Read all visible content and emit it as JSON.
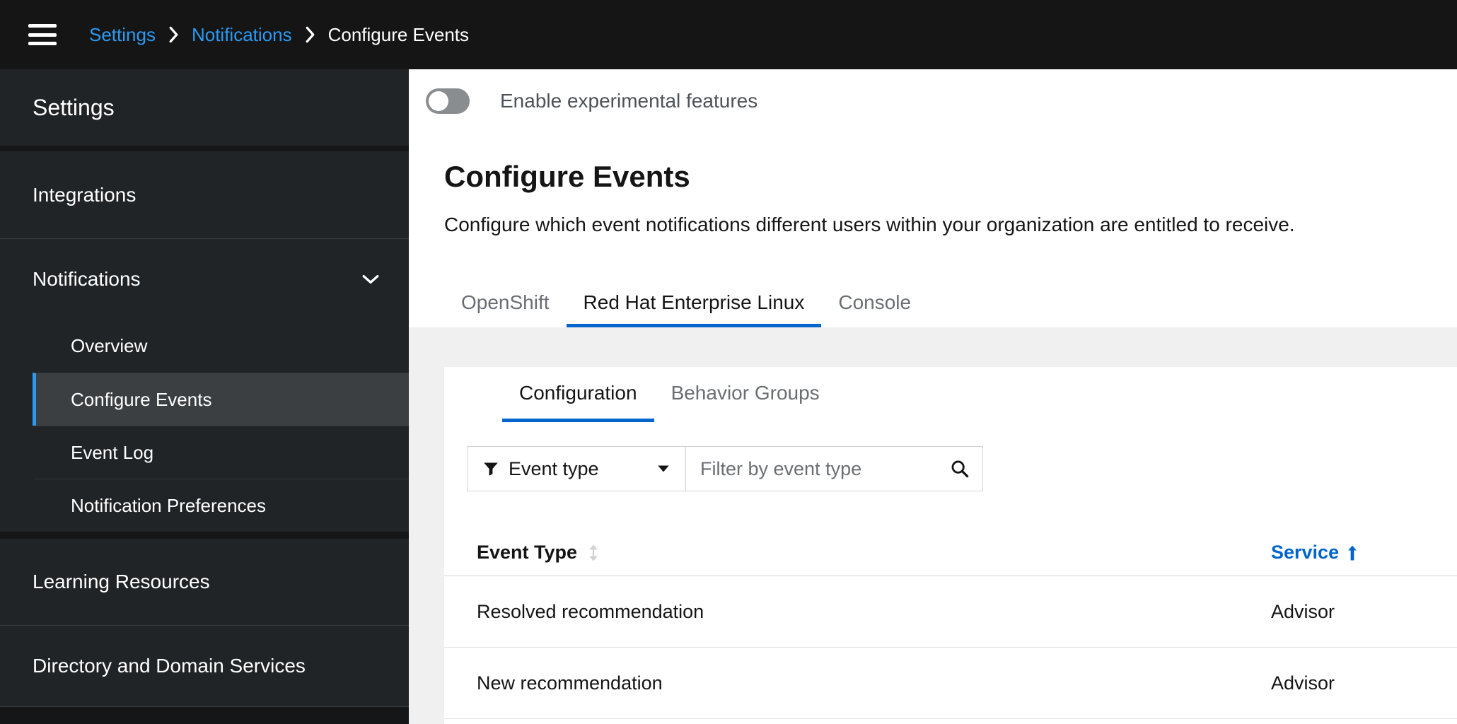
{
  "breadcrumb": {
    "items": [
      {
        "label": "Settings"
      },
      {
        "label": "Notifications"
      },
      {
        "label": "Configure Events"
      }
    ]
  },
  "sidebar": {
    "title": "Settings",
    "integrations": "Integrations",
    "notifications": "Notifications",
    "subitems": [
      {
        "label": "Overview"
      },
      {
        "label": "Configure Events"
      },
      {
        "label": "Event Log"
      },
      {
        "label": "Notification Preferences"
      }
    ],
    "learning": "Learning Resources",
    "directory": "Directory and Domain Services"
  },
  "main": {
    "toggle_label": "Enable experimental features",
    "toggle_state": "off",
    "title": "Configure Events",
    "description": "Configure which event notifications different users within your organization are entitled to receive.",
    "tabs": [
      {
        "label": "OpenShift"
      },
      {
        "label": "Red Hat Enterprise Linux"
      },
      {
        "label": "Console"
      }
    ],
    "subtabs": [
      {
        "label": "Configuration"
      },
      {
        "label": "Behavior Groups"
      }
    ],
    "filter": {
      "dropdown_label": "Event type",
      "placeholder": "Filter by event type"
    },
    "table": {
      "col_event": "Event Type",
      "col_service": "Service",
      "sort_direction": "asc",
      "rows": [
        {
          "event": "Resolved recommendation",
          "service": "Advisor"
        },
        {
          "event": "New recommendation",
          "service": "Advisor"
        }
      ]
    }
  },
  "colors": {
    "accent": "#0066cc",
    "dark_link": "#2b9af3",
    "masthead_bg": "#151515",
    "sidebar_bg": "#212427",
    "selected_nav_bg": "#3c3f42"
  }
}
